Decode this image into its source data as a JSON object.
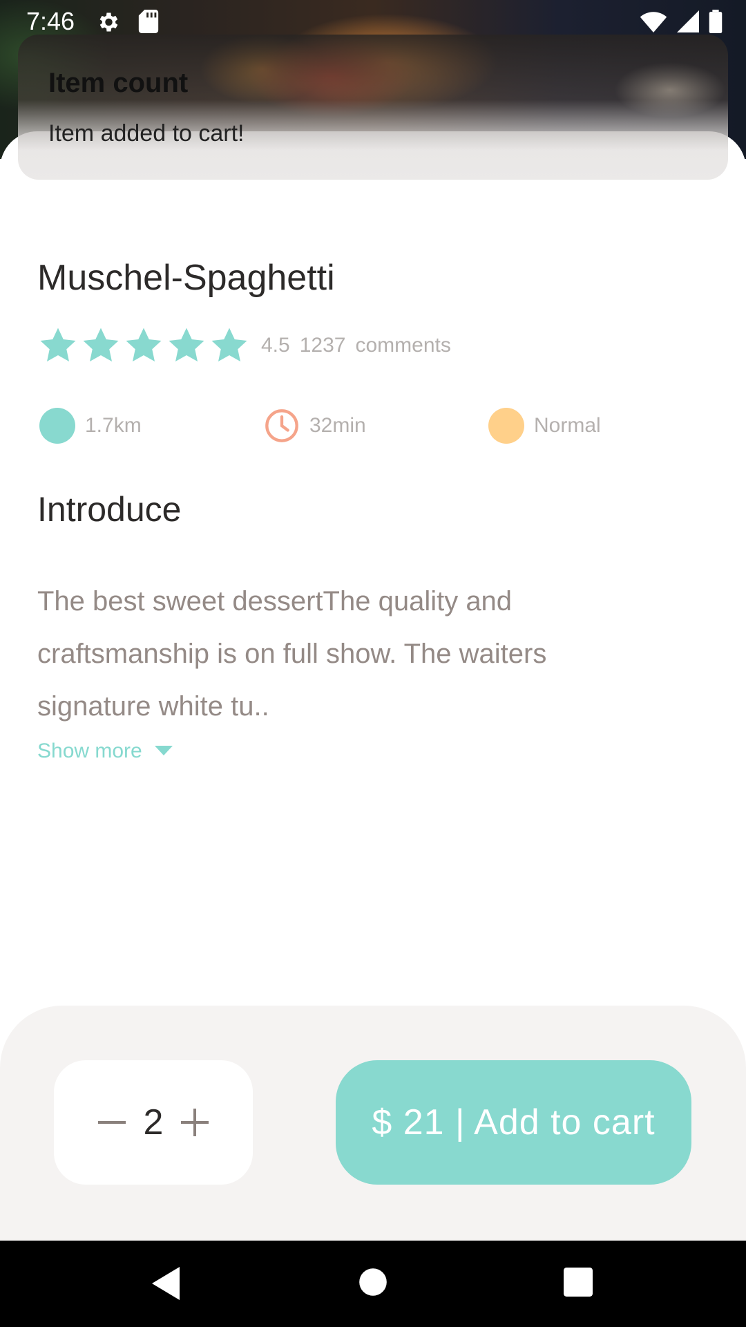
{
  "status_bar": {
    "time": "7:46"
  },
  "toast": {
    "title": "Item count",
    "message": "Item added to cart!"
  },
  "dish": {
    "name": "Muschel-Spaghetti",
    "rating": "4.5",
    "rating_value": 4.5,
    "comment_count": "1237",
    "comments_label": "comments",
    "star_count": 5
  },
  "info": {
    "distance": "1.7km",
    "time": "32min",
    "level": "Normal"
  },
  "introduce": {
    "title": "Introduce",
    "text": "The best sweet dessertThe quality and craftsmanship is on full show. The waiters signature white tu..",
    "show_more": "Show more"
  },
  "cart": {
    "quantity": "2",
    "button_label": "$ 21 | Add to cart"
  },
  "colors": {
    "accent": "#88d9cf",
    "clock": "#f5a48a",
    "level": "#ffd08a",
    "distance": "#88d9cf"
  },
  "icons": [
    "gear-icon",
    "sd-card-icon",
    "wifi-icon",
    "signal-icon",
    "battery-icon",
    "star-icon",
    "clock-icon",
    "chevron-down-icon",
    "minus-icon",
    "plus-icon",
    "back-icon",
    "home-icon",
    "recents-icon"
  ]
}
